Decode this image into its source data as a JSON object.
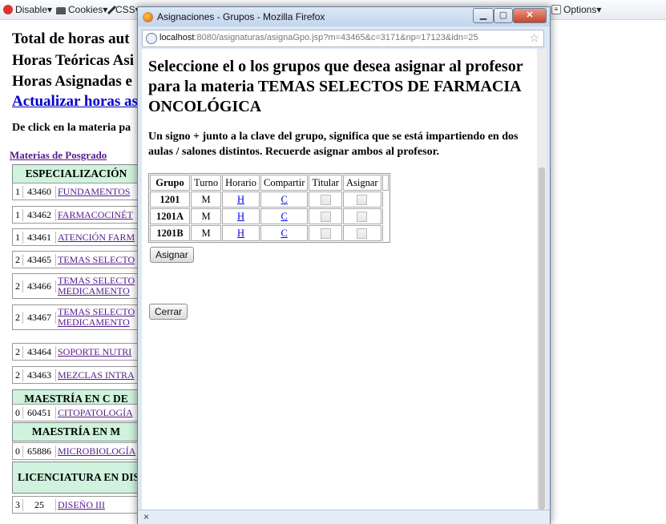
{
  "devbar": {
    "disable": "Disable▾",
    "cookies": "Cookies▾",
    "css": "CSS▾",
    "options": "Options▾"
  },
  "background": {
    "h1": "Total de horas aut",
    "h2": "Horas Teóricas Asi",
    "h3": "Horas Asignadas e",
    "update_link": "Actualizar horas as",
    "note": "De click en la materia pa",
    "posgrado_link": "Materias de Posgrado",
    "sections": [
      {
        "title": "ESPECIALIZACIÓN"
      },
      {
        "title": "MAESTRÍA EN C DE"
      },
      {
        "title": "MAESTRÍA EN M"
      },
      {
        "title": "LICENCIATURA EN DIS"
      }
    ],
    "rows": [
      {
        "n": "1",
        "code": "43460",
        "name": "FUNDAMENTOS"
      },
      {
        "n": "1",
        "code": "43462",
        "name": "FARMACOCINÉT"
      },
      {
        "n": "1",
        "code": "43461",
        "name": "ATENCIÓN FARM"
      },
      {
        "n": "2",
        "code": "43465",
        "name": "TEMAS SELECTO"
      },
      {
        "n": "2",
        "code": "43466",
        "name": "TEMAS SELECTO",
        "name2": "MEDICAMENTO"
      },
      {
        "n": "2",
        "code": "43467",
        "name": "TEMAS SELECTO",
        "name2": "MEDICAMENTO"
      },
      {
        "n": "2",
        "code": "43464",
        "name": "SOPORTE NUTRI"
      },
      {
        "n": "2",
        "code": "43463",
        "name": "MEZCLAS INTRA"
      },
      {
        "n": "0",
        "code": "60451",
        "name": "CITOPATOLOGÍA"
      },
      {
        "n": "0",
        "code": "65886",
        "name": "MICROBIOLOGÍA"
      },
      {
        "n": "3",
        "code": "25",
        "name": "DISEÑO III"
      }
    ]
  },
  "popup": {
    "title": "Asignaciones - Grupos - Mozilla Firefox",
    "url_host": "localhost",
    "url_rest": ":8080/asignaturas/asignaGpo.jsp?m=43465&c=3171&np=17123&idn=25",
    "heading": "Seleccione el o los grupos que desea asignar al profesor para la materia TEMAS SELECTOS DE FARMACIA ONCOLÓGICA",
    "info": "Un signo + junto a la clave del grupo, significa que se está impartiendo en dos aulas / salones distintos. Recuerde asignar ambos al profesor.",
    "columns": [
      "Grupo",
      "Turno",
      "Horario",
      "Compartir",
      "Titular",
      "Asignar"
    ],
    "groups": [
      {
        "grupo": "1201",
        "turno": "M",
        "horario": "H",
        "compartir": "C"
      },
      {
        "grupo": "1201A",
        "turno": "M",
        "horario": "H",
        "compartir": "C"
      },
      {
        "grupo": "1201B",
        "turno": "M",
        "horario": "H",
        "compartir": "C"
      }
    ],
    "assign_button": "Asignar",
    "close_button": "Cerrar",
    "status_close": "×"
  },
  "colors": {
    "section_bg": "#cff3dd",
    "link": "#0000ee",
    "visited": "#551a8b"
  }
}
